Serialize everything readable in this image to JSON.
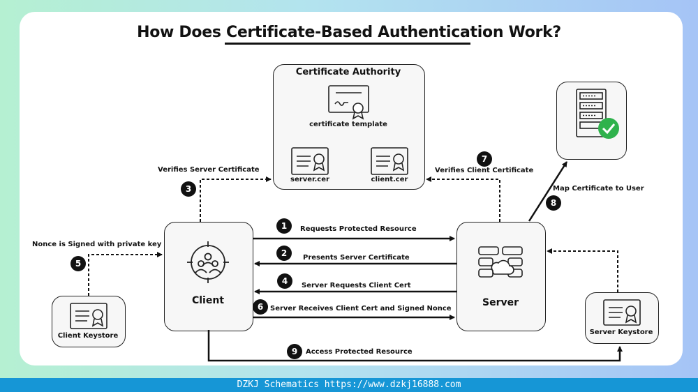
{
  "title": "How Does Certificate-Based Authentication Work?",
  "nodes": {
    "ca": {
      "label": "Certificate Authority",
      "template_label": "certificate template",
      "server_cert": "server.cer",
      "client_cert": "client.cer"
    },
    "client": {
      "label": "Client"
    },
    "server": {
      "label": "Server"
    },
    "client_keystore": {
      "label": "Client Keystore"
    },
    "server_keystore": {
      "label": "Server Keystore"
    }
  },
  "steps": [
    {
      "num": "1",
      "label": "Requests Protected Resource"
    },
    {
      "num": "2",
      "label": "Presents Server Certificate"
    },
    {
      "num": "3",
      "label": "Verifies Server Certificate"
    },
    {
      "num": "4",
      "label": "Server Requests Client Cert"
    },
    {
      "num": "5",
      "label": "Nonce is Signed with private key"
    },
    {
      "num": "6",
      "label": "Server Receives Client Cert and Signed Nonce"
    },
    {
      "num": "7",
      "label": "Verifies Client Certificate"
    },
    {
      "num": "8",
      "label": "Map Certificate to User"
    },
    {
      "num": "9",
      "label": "Access Protected Resource"
    }
  ],
  "icons": {
    "check": "check-icon",
    "database": "server-rack-icon"
  },
  "colors": {
    "check": "#2fb24c",
    "footer": "#1696d6"
  },
  "footer": "DZKJ Schematics https://www.dzkj16888.com"
}
